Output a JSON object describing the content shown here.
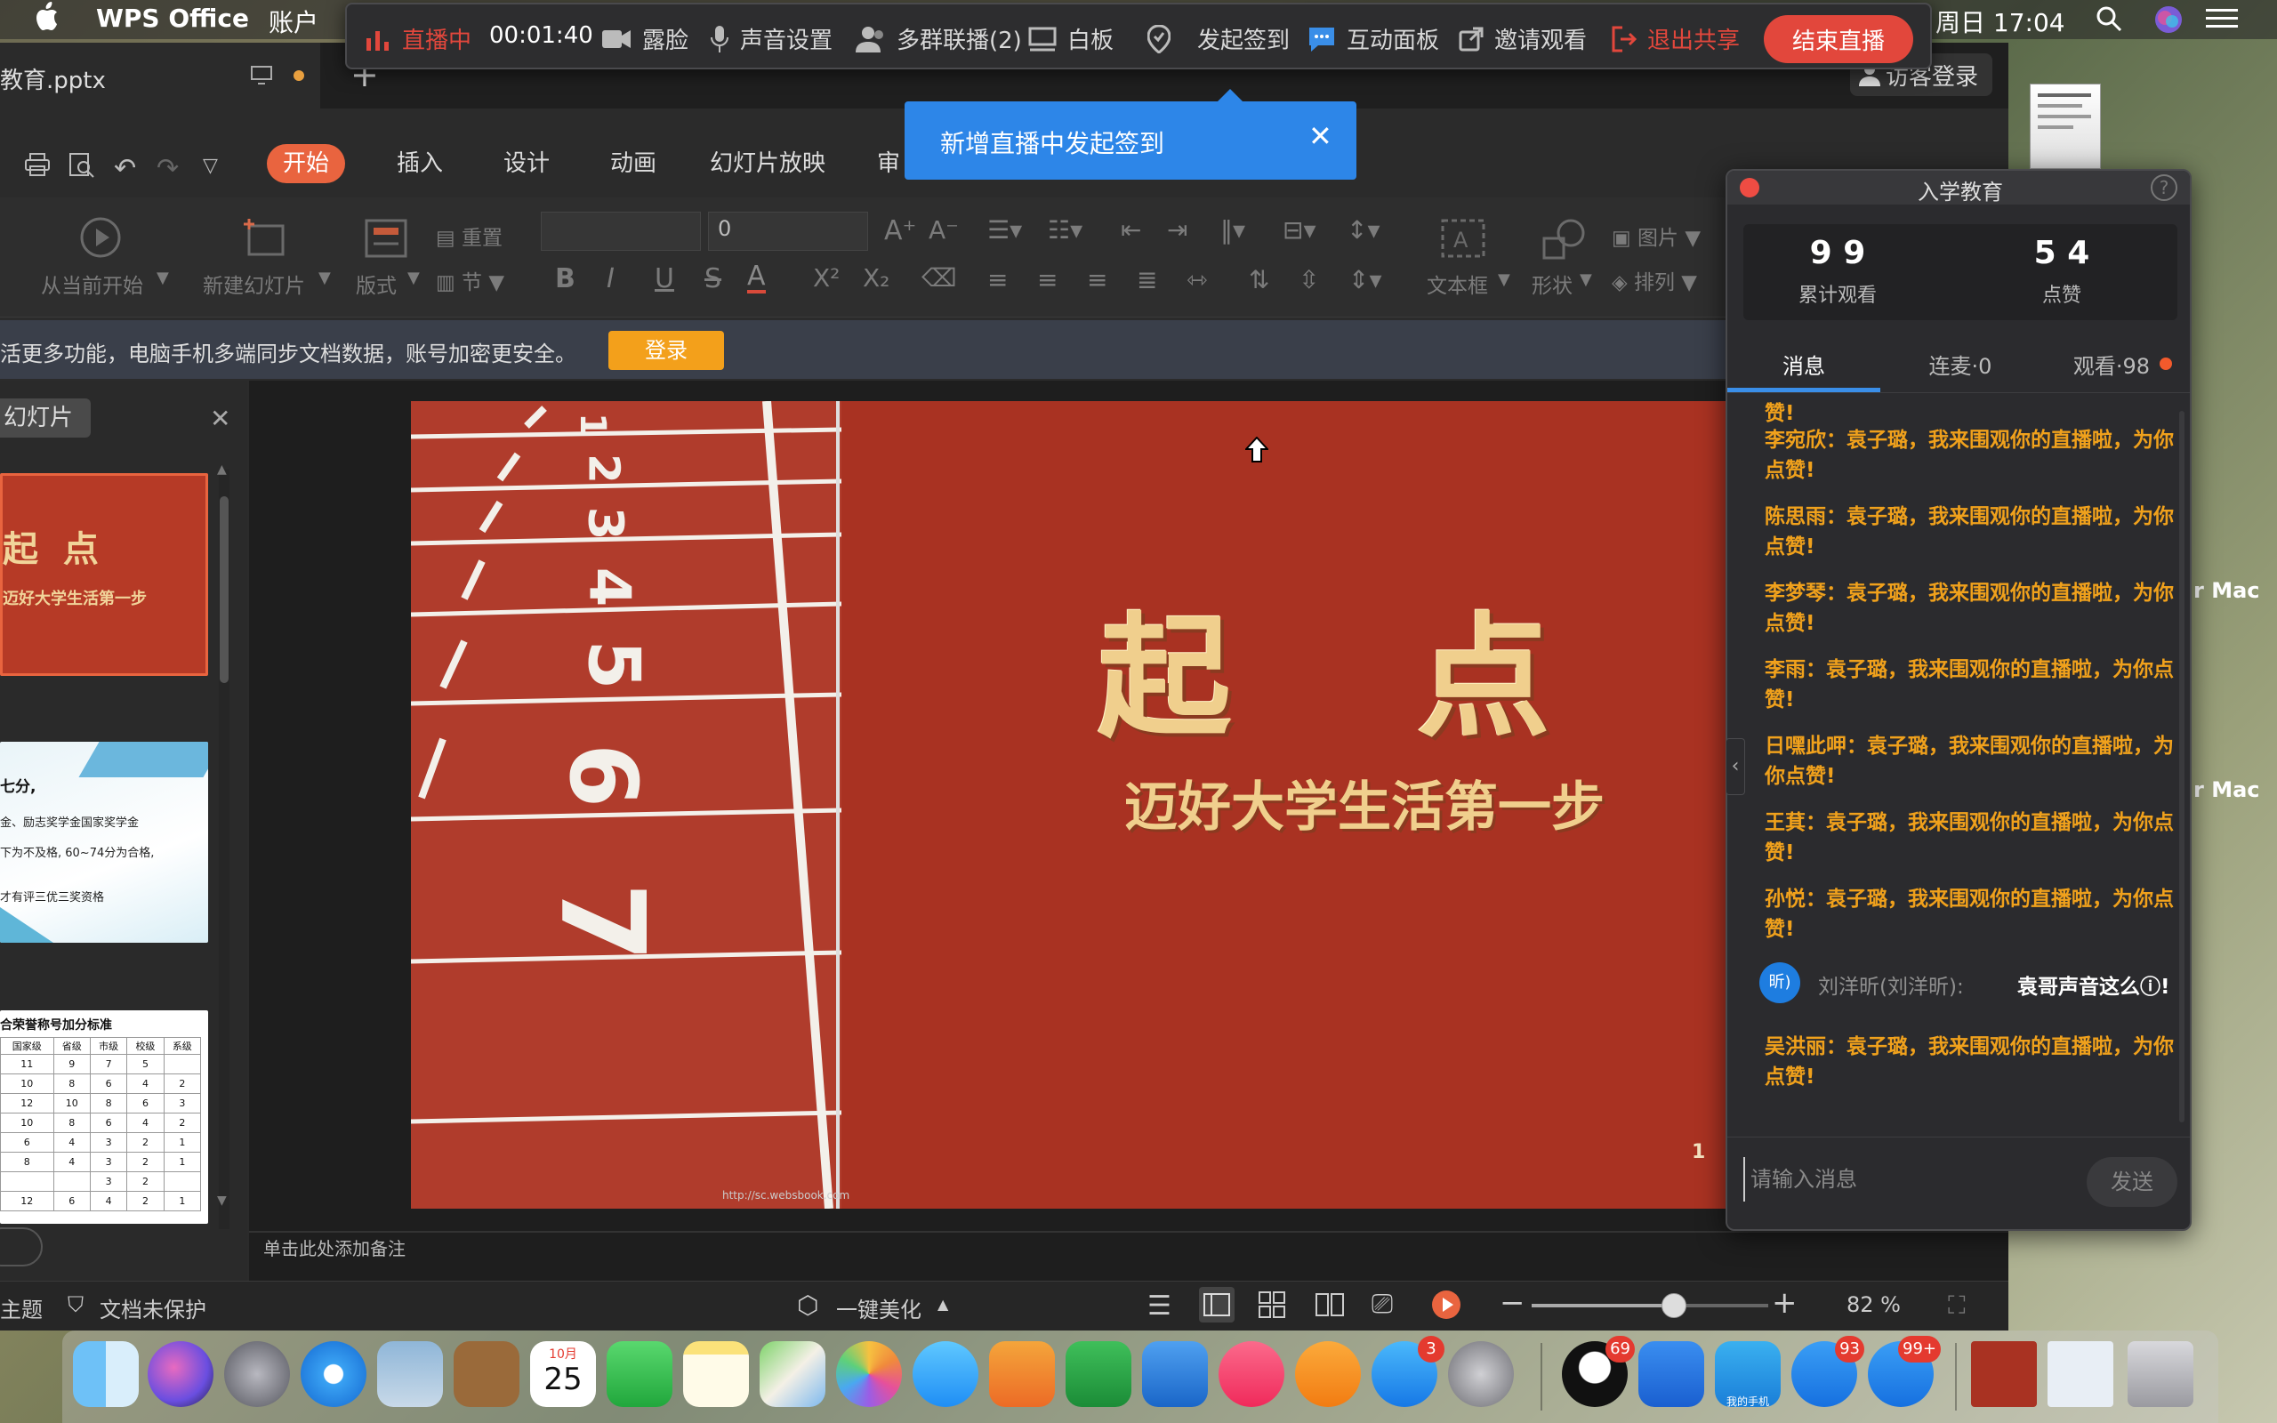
{
  "menubar": {
    "app": "WPS Office",
    "account": "账户",
    "datetime": "周日 17:04"
  },
  "livebar": {
    "status": "直播中",
    "timer": "00:01:40",
    "face": "露脸",
    "sound": "声音设置",
    "multigroup": "多群联播(2)",
    "whiteboard": "白板",
    "checkin": "发起签到",
    "interact": "互动面板",
    "invite": "邀请观看",
    "exit_share": "退出共享",
    "end": "结束直播"
  },
  "toast": {
    "text": "新增直播中发起签到"
  },
  "tabs": {
    "doc_tab": "教育.pptx",
    "guest_login": "访客登录"
  },
  "ribbon_tabs": [
    "开始",
    "插入",
    "设计",
    "动画",
    "幻灯片放映",
    "审"
  ],
  "ribbon": {
    "from_current": "从当前开始",
    "new_slide": "新建幻灯片",
    "layout": "版式",
    "reset": "重置",
    "section": "节",
    "font_size": "0",
    "textbox": "文本框",
    "shape": "形状",
    "picture": "图片",
    "arrange": "排列"
  },
  "notice": {
    "text": "活更多功能，电脑手机多端同步文档数据，账号加密更安全。",
    "login": "登录"
  },
  "sidebar": {
    "title": "幻灯片"
  },
  "thumbs": {
    "t1_title": "起  点",
    "t1_sub": "迈好大学生活第一步",
    "t2_lines": [
      "七分,",
      "金、励志奖学金国家奖学金",
      "下为不及格, 60~74分为合格,",
      "才有评三优三奖资格"
    ],
    "t3_title": "合荣誉称号加分标准",
    "t3_headers": [
      "国家级",
      "省级",
      "市级",
      "校级",
      "系级"
    ],
    "t3_rows": [
      [
        "11",
        "9",
        "7",
        "5",
        ""
      ],
      [
        "10",
        "8",
        "6",
        "4",
        "2"
      ],
      [
        "12",
        "10",
        "8",
        "6",
        "3"
      ],
      [
        "10",
        "8",
        "6",
        "4",
        "2"
      ],
      [
        "6",
        "4",
        "3",
        "2",
        "1"
      ],
      [
        "8",
        "4",
        "3",
        "2",
        "1"
      ],
      [
        "",
        "",
        "3",
        "2",
        ""
      ],
      [
        "12",
        "6",
        "4",
        "2",
        "1"
      ]
    ]
  },
  "slide": {
    "title": "起    点",
    "subtitle": "迈好大学生活第一步",
    "page_number": "1",
    "watermark": "http://sc.websbook.com",
    "lane_numbers": [
      "1",
      "2",
      "3",
      "4",
      "5",
      "6",
      "7"
    ]
  },
  "notes": {
    "placeholder": "单击此处添加备注"
  },
  "statusbar": {
    "theme": "主题",
    "protect": "文档未保护",
    "beautify": "一键美化",
    "zoom": "82 %",
    "zoom_fraction": 0.6
  },
  "panel": {
    "title": "入学教育",
    "total_views_value": "9 9",
    "total_views_label": "累计观看",
    "likes_value": "5 4",
    "likes_label": "点赞",
    "tabs": [
      "消息",
      "连麦·0",
      "观看·98"
    ],
    "messages": [
      {
        "text": "王真：袁子璐，我来围观你的直播啦，为你点赞!"
      },
      {
        "text": "李宛欣：袁子璐，我来围观你的直播啦，为你点赞!"
      },
      {
        "text": "陈思雨：袁子璐，我来围观你的直播啦，为你点赞!"
      },
      {
        "text": "李梦琴：袁子璐，我来围观你的直播啦，为你点赞!"
      },
      {
        "text": "李雨：袁子璐，我来围观你的直播啦，为你点赞!"
      },
      {
        "text": "日嘿此呷：袁子璐，我来围观你的直播啦，为你点赞!"
      },
      {
        "text": "王萁：袁子璐，我来围观你的直播啦，为你点赞!"
      },
      {
        "text": "孙悦：袁子璐，我来围观你的直播啦，为你点赞!"
      }
    ],
    "chat": {
      "avatar": "昕)",
      "name": "刘洋昕(刘洋昕):",
      "text": "袁哥声音这么ⓘ!"
    },
    "last_message": "吴洪丽：袁子璐，我来围观你的直播啦，为你点赞!",
    "input_placeholder": "请输入消息",
    "send": "发送"
  },
  "desktop": {
    "item1": "r Mac",
    "item2": "r Mac"
  },
  "dock": {
    "calendar_month": "10月",
    "calendar_day": "25",
    "my_phone": "我的手机",
    "badges": {
      "appstore": "3",
      "qq": "69",
      "feishu1": "93",
      "feishu2": "99+"
    }
  },
  "colors": {
    "accent": "#e9643f",
    "live_red": "#e2473c",
    "message_orange": "#f0a11c",
    "toast_blue": "#2d86e8",
    "slide_red": "#a93222"
  }
}
